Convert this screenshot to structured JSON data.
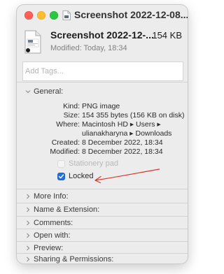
{
  "window": {
    "title": "Screenshot 2022-12-08..."
  },
  "file": {
    "name": "Screenshot 2022-12-...",
    "size": "154 KB",
    "modified": "Modified: Today, 18:34"
  },
  "tags": {
    "placeholder": "Add Tags..."
  },
  "general": {
    "label": "General:",
    "rows": [
      {
        "key": "Kind:",
        "value": "PNG image"
      },
      {
        "key": "Size:",
        "value": "154 355 bytes (156 KB on disk)"
      },
      {
        "key": "Where:",
        "value": "Macintosh HD ▸ Users ▸"
      },
      {
        "key": "",
        "value": "ulianakharyna ▸ Downloads"
      },
      {
        "key": "Created:",
        "value": "8 December 2022, 18:34"
      },
      {
        "key": "Modified:",
        "value": "8 December 2022, 18:34"
      }
    ],
    "stationery_label": "Stationery pad",
    "stationery_checked": false,
    "locked_label": "Locked",
    "locked_checked": true
  },
  "sections": [
    {
      "label": "More Info:"
    },
    {
      "label": "Name & Extension:"
    },
    {
      "label": "Comments:"
    },
    {
      "label": "Open with:"
    },
    {
      "label": "Preview:"
    },
    {
      "label": "Sharing & Permissions:"
    }
  ],
  "colors": {
    "annotation_arrow": "#d9352b",
    "checkbox_accent": "#1f6fe5"
  }
}
